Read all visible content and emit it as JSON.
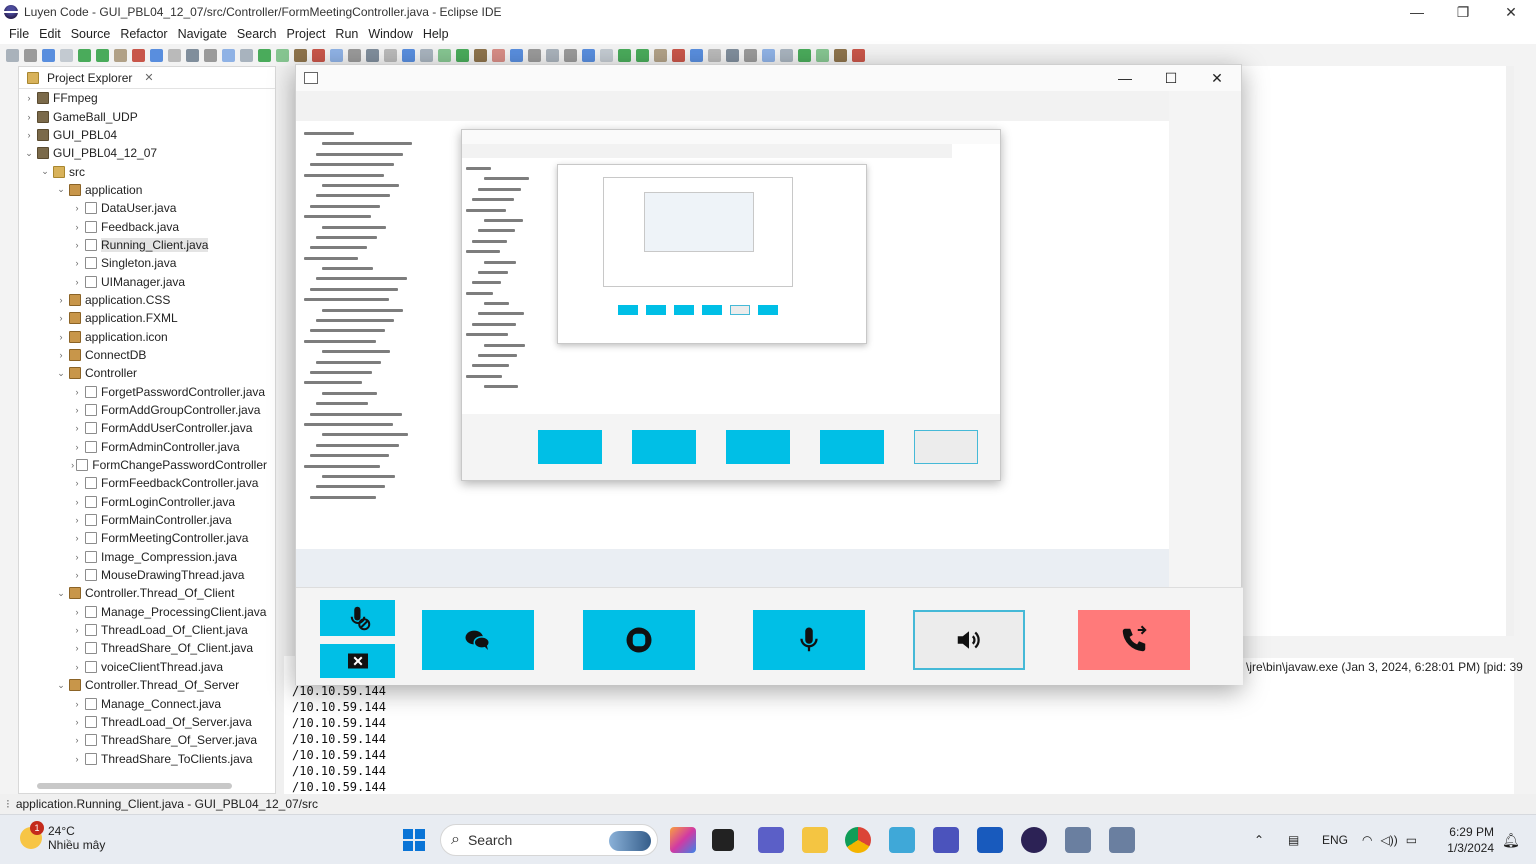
{
  "window": {
    "title": "Luyen Code - GUI_PBL04_12_07/src/Controller/FormMeetingController.java - Eclipse IDE"
  },
  "menu": [
    "File",
    "Edit",
    "Source",
    "Refactor",
    "Navigate",
    "Search",
    "Project",
    "Run",
    "Window",
    "Help"
  ],
  "explorer": {
    "tab_label": "Project Explorer",
    "tree": [
      {
        "label": "FFmpeg",
        "type": "project",
        "depth": 0,
        "twist": "›"
      },
      {
        "label": "GameBall_UDP",
        "type": "project",
        "depth": 0,
        "twist": "›"
      },
      {
        "label": "GUI_PBL04",
        "type": "project",
        "depth": 0,
        "twist": "›"
      },
      {
        "label": "GUI_PBL04_12_07",
        "type": "project",
        "depth": 0,
        "twist": "⌄"
      },
      {
        "label": "src",
        "type": "folder",
        "depth": 1,
        "twist": "⌄"
      },
      {
        "label": "application",
        "type": "pkg",
        "depth": 2,
        "twist": "⌄"
      },
      {
        "label": "DataUser.java",
        "type": "file",
        "depth": 3,
        "twist": "›"
      },
      {
        "label": "Feedback.java",
        "type": "file",
        "depth": 3,
        "twist": "›"
      },
      {
        "label": "Running_Client.java",
        "type": "file",
        "depth": 3,
        "twist": "›",
        "selected": true
      },
      {
        "label": "Singleton.java",
        "type": "file",
        "depth": 3,
        "twist": "›"
      },
      {
        "label": "UIManager.java",
        "type": "file",
        "depth": 3,
        "twist": "›"
      },
      {
        "label": "application.CSS",
        "type": "pkg",
        "depth": 2,
        "twist": "›"
      },
      {
        "label": "application.FXML",
        "type": "pkg",
        "depth": 2,
        "twist": "›"
      },
      {
        "label": "application.icon",
        "type": "pkg",
        "depth": 2,
        "twist": "›"
      },
      {
        "label": "ConnectDB",
        "type": "pkg",
        "depth": 2,
        "twist": "›"
      },
      {
        "label": "Controller",
        "type": "pkg",
        "depth": 2,
        "twist": "⌄"
      },
      {
        "label": "ForgetPasswordController.java",
        "type": "file",
        "depth": 3,
        "twist": "›"
      },
      {
        "label": "FormAddGroupController.java",
        "type": "file",
        "depth": 3,
        "twist": "›"
      },
      {
        "label": "FormAddUserController.java",
        "type": "file",
        "depth": 3,
        "twist": "›"
      },
      {
        "label": "FormAdminController.java",
        "type": "file",
        "depth": 3,
        "twist": "›"
      },
      {
        "label": "FormChangePasswordController",
        "type": "file",
        "depth": 3,
        "twist": "›"
      },
      {
        "label": "FormFeedbackController.java",
        "type": "file",
        "depth": 3,
        "twist": "›"
      },
      {
        "label": "FormLoginController.java",
        "type": "file",
        "depth": 3,
        "twist": "›"
      },
      {
        "label": "FormMainController.java",
        "type": "file",
        "depth": 3,
        "twist": "›"
      },
      {
        "label": "FormMeetingController.java",
        "type": "file",
        "depth": 3,
        "twist": "›"
      },
      {
        "label": "Image_Compression.java",
        "type": "file",
        "depth": 3,
        "twist": "›"
      },
      {
        "label": "MouseDrawingThread.java",
        "type": "file",
        "depth": 3,
        "twist": "›"
      },
      {
        "label": "Controller.Thread_Of_Client",
        "type": "pkg",
        "depth": 2,
        "twist": "⌄"
      },
      {
        "label": "Manage_ProcessingClient.java",
        "type": "file",
        "depth": 3,
        "twist": "›"
      },
      {
        "label": "ThreadLoad_Of_Client.java",
        "type": "file",
        "depth": 3,
        "twist": "›"
      },
      {
        "label": "ThreadShare_Of_Client.java",
        "type": "file",
        "depth": 3,
        "twist": "›"
      },
      {
        "label": "voiceClientThread.java",
        "type": "file",
        "depth": 3,
        "twist": "›"
      },
      {
        "label": "Controller.Thread_Of_Server",
        "type": "pkg",
        "depth": 2,
        "twist": "⌄"
      },
      {
        "label": "Manage_Connect.java",
        "type": "file",
        "depth": 3,
        "twist": "›"
      },
      {
        "label": "ThreadLoad_Of_Server.java",
        "type": "file",
        "depth": 3,
        "twist": "›"
      },
      {
        "label": "ThreadShare_Of_Server.java",
        "type": "file",
        "depth": 3,
        "twist": "›"
      },
      {
        "label": "ThreadShare_ToClients.java",
        "type": "file",
        "depth": 3,
        "twist": "›"
      }
    ]
  },
  "console": {
    "header": "\\jre\\bin\\javaw.exe  (Jan 3, 2024, 6:28:01 PM) [pid: 39",
    "lines": [
      "/10.10.59.144",
      "/10.10.59.144",
      "/10.10.59.144",
      "/10.10.59.144",
      "/10.10.59.144",
      "/10.10.59.144",
      "/10.10.59.144"
    ]
  },
  "status": {
    "text": "application.Running_Client.java - GUI_PBL04_12_07/src"
  },
  "meeting": {
    "buttons": [
      {
        "name": "mic-off-button",
        "icon": "mic-off-icon"
      },
      {
        "name": "stop-share-button",
        "icon": "stop-icon"
      },
      {
        "name": "chat-button",
        "icon": "chat-icon"
      },
      {
        "name": "record-button",
        "icon": "record-icon"
      },
      {
        "name": "mic-button",
        "icon": "mic-icon"
      },
      {
        "name": "speaker-button",
        "icon": "speaker-icon"
      },
      {
        "name": "leave-call-button",
        "icon": "phone-leave-icon"
      }
    ],
    "colors": {
      "primary": "#00bfe6",
      "leave": "#ff7a7a",
      "speaker_bg": "#ececec"
    }
  },
  "taskbar": {
    "weather_temp": "24°C",
    "weather_desc": "Nhiều mây",
    "weather_badge": "1",
    "search_label": "Search",
    "lang": "ENG",
    "time": "6:29 PM",
    "date": "1/3/2024"
  }
}
